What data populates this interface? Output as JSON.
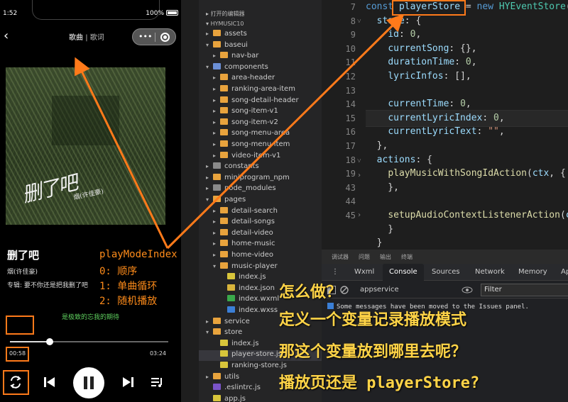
{
  "phone": {
    "time": "1:52",
    "battery": "100%",
    "nav": {
      "active_tab": "歌曲",
      "separator": "|",
      "inactive_tab": "歌词"
    },
    "cover": {
      "script_text": "删了吧",
      "script_sub": "烟(许佳豪)"
    },
    "song_title": "删了吧",
    "singer": "烟(许佳豪)",
    "album": "专辑: 要不你还是把我删了吧",
    "lyric": "是极致的忘我的期待",
    "progress": 0.25,
    "current_time": "00:58",
    "total_time": "03:24"
  },
  "annotation": {
    "title": "playModeIndex",
    "line1": "0: 顺序",
    "line2": "1:  单曲循环",
    "line3": "2:  随机播放"
  },
  "explorer": {
    "open_editors": "打开的编辑器",
    "project": "HYMUSIC10",
    "items": [
      {
        "label": "assets",
        "icon": "folder",
        "depth": 1,
        "arrow": "▸"
      },
      {
        "label": "baseui",
        "icon": "folder",
        "depth": 1,
        "arrow": "▾"
      },
      {
        "label": "nav-bar",
        "icon": "folder",
        "depth": 2,
        "arrow": "▸"
      },
      {
        "label": "components",
        "icon": "folder-blue",
        "depth": 1,
        "arrow": "▾"
      },
      {
        "label": "area-header",
        "icon": "folder",
        "depth": 2,
        "arrow": "▸"
      },
      {
        "label": "ranking-area-item",
        "icon": "folder",
        "depth": 2,
        "arrow": "▸"
      },
      {
        "label": "song-detail-header",
        "icon": "folder",
        "depth": 2,
        "arrow": "▸"
      },
      {
        "label": "song-item-v1",
        "icon": "folder",
        "depth": 2,
        "arrow": "▸"
      },
      {
        "label": "song-item-v2",
        "icon": "folder",
        "depth": 2,
        "arrow": "▸"
      },
      {
        "label": "song-menu-area",
        "icon": "folder",
        "depth": 2,
        "arrow": "▸"
      },
      {
        "label": "song-menu-item",
        "icon": "folder",
        "depth": 2,
        "arrow": "▸"
      },
      {
        "label": "video-item-v1",
        "icon": "folder",
        "depth": 2,
        "arrow": "▸"
      },
      {
        "label": "constants",
        "icon": "folder-gray",
        "depth": 1,
        "arrow": "▸"
      },
      {
        "label": "miniprogram_npm",
        "icon": "folder",
        "depth": 1,
        "arrow": "▸"
      },
      {
        "label": "node_modules",
        "icon": "folder-gray",
        "depth": 1,
        "arrow": "▸"
      },
      {
        "label": "pages",
        "icon": "folder",
        "depth": 1,
        "arrow": "▾"
      },
      {
        "label": "detail-search",
        "icon": "folder",
        "depth": 2,
        "arrow": "▸"
      },
      {
        "label": "detail-songs",
        "icon": "folder",
        "depth": 2,
        "arrow": "▸"
      },
      {
        "label": "detail-video",
        "icon": "folder",
        "depth": 2,
        "arrow": "▸"
      },
      {
        "label": "home-music",
        "icon": "folder",
        "depth": 2,
        "arrow": "▸"
      },
      {
        "label": "home-video",
        "icon": "folder",
        "depth": 2,
        "arrow": "▸"
      },
      {
        "label": "music-player",
        "icon": "folder",
        "depth": 2,
        "arrow": "▾"
      },
      {
        "label": "index.js",
        "icon": "js",
        "depth": 3,
        "arrow": ""
      },
      {
        "label": "index.json",
        "icon": "json",
        "depth": 3,
        "arrow": ""
      },
      {
        "label": "index.wxml",
        "icon": "wxml",
        "depth": 3,
        "arrow": ""
      },
      {
        "label": "index.wxss",
        "icon": "wxss",
        "depth": 3,
        "arrow": ""
      },
      {
        "label": "service",
        "icon": "folder",
        "depth": 1,
        "arrow": "▸"
      },
      {
        "label": "store",
        "icon": "folder",
        "depth": 1,
        "arrow": "▾"
      },
      {
        "label": "index.js",
        "icon": "js",
        "depth": 2,
        "arrow": ""
      },
      {
        "label": "player-store.js",
        "icon": "js",
        "depth": 2,
        "arrow": ""
      },
      {
        "label": "ranking-store.js",
        "icon": "js",
        "depth": 2,
        "arrow": ""
      },
      {
        "label": "utils",
        "icon": "folder",
        "depth": 1,
        "arrow": "▸"
      },
      {
        "label": ".eslintrc.js",
        "icon": "rc",
        "depth": 1,
        "arrow": ""
      },
      {
        "label": "app.js",
        "icon": "js",
        "depth": 1,
        "arrow": ""
      }
    ]
  },
  "editor": {
    "lines": [
      {
        "no": "7",
        "tokens": [
          [
            "k",
            "const "
          ],
          [
            "v",
            "playerStore"
          ],
          [
            "p",
            " = "
          ],
          [
            "k",
            "new "
          ],
          [
            "c",
            "HYEventStore"
          ],
          [
            "p",
            "("
          ]
        ]
      },
      {
        "no": "8",
        "tokens": [
          [
            "p",
            "  "
          ],
          [
            "v",
            "state"
          ],
          [
            "p",
            ": {"
          ]
        ]
      },
      {
        "no": "9",
        "tokens": [
          [
            "p",
            "    "
          ],
          [
            "v",
            "id"
          ],
          [
            "p",
            ": "
          ],
          [
            "n",
            "0"
          ],
          [
            "p",
            ","
          ]
        ]
      },
      {
        "no": "10",
        "tokens": [
          [
            "p",
            "    "
          ],
          [
            "v",
            "currentSong"
          ],
          [
            "p",
            ": {},"
          ]
        ]
      },
      {
        "no": "11",
        "tokens": [
          [
            "p",
            "    "
          ],
          [
            "v",
            "durationTime"
          ],
          [
            "p",
            ": "
          ],
          [
            "n",
            "0"
          ],
          [
            "p",
            ","
          ]
        ]
      },
      {
        "no": "12",
        "tokens": [
          [
            "p",
            "    "
          ],
          [
            "v",
            "lyricInfos"
          ],
          [
            "p",
            ": [],"
          ]
        ]
      },
      {
        "no": "13",
        "tokens": []
      },
      {
        "no": "14",
        "tokens": [
          [
            "p",
            "    "
          ],
          [
            "v",
            "currentTime"
          ],
          [
            "p",
            ": "
          ],
          [
            "n",
            "0"
          ],
          [
            "p",
            ","
          ]
        ]
      },
      {
        "no": "15",
        "tokens": [
          [
            "p",
            "    "
          ],
          [
            "v",
            "currentLyricIndex"
          ],
          [
            "p",
            ": "
          ],
          [
            "n",
            "0"
          ],
          [
            "p",
            ","
          ]
        ]
      },
      {
        "no": "16",
        "tokens": [
          [
            "p",
            "    "
          ],
          [
            "v",
            "currentLyricText"
          ],
          [
            "p",
            ": "
          ],
          [
            "s",
            "\"\""
          ],
          [
            "p",
            ","
          ]
        ]
      },
      {
        "no": "17",
        "tokens": [
          [
            "p",
            "  },"
          ]
        ]
      },
      {
        "no": "18",
        "tokens": [
          [
            "p",
            "  "
          ],
          [
            "v",
            "actions"
          ],
          [
            "p",
            ": {"
          ]
        ]
      },
      {
        "no": "19",
        "tokens": [
          [
            "p",
            "    "
          ],
          [
            "f",
            "playMusicWithSongIdAction"
          ],
          [
            "p",
            "("
          ],
          [
            "v",
            "ctx"
          ],
          [
            "p",
            ", {"
          ]
        ]
      },
      {
        "no": "43",
        "tokens": [
          [
            "p",
            "    },"
          ]
        ]
      },
      {
        "no": "44",
        "tokens": []
      },
      {
        "no": "45",
        "tokens": [
          [
            "p",
            "    "
          ],
          [
            "f",
            "setupAudioContextListenerAction"
          ],
          [
            "p",
            "("
          ],
          [
            "v",
            "c"
          ]
        ]
      },
      {
        "no": "",
        "tokens": [
          [
            "p",
            "    }"
          ]
        ]
      },
      {
        "no": "",
        "tokens": [
          [
            "p",
            "  }"
          ]
        ]
      }
    ]
  },
  "devtools": {
    "top_tabs": [
      "调试器",
      "问题",
      "输出",
      "终端"
    ],
    "tabs": [
      "Wxml",
      "Console",
      "Sources",
      "Network",
      "Memory",
      "Ap"
    ],
    "active_tab": "Console",
    "context": "appservice",
    "filter_placeholder": "Filter",
    "message": "Some messages have been moved to the Issues panel."
  },
  "overlay": {
    "line1": "怎么做？",
    "line2": "定义一个变量记录播放模式",
    "line3": "那这个变量放到哪里去呢？",
    "line4": "播放页还是 playerStore?"
  },
  "colors": {
    "highlight_box": "#ff7a1a",
    "overlay_text": "#ffd447",
    "annotation_text": "#ff8c1a"
  }
}
